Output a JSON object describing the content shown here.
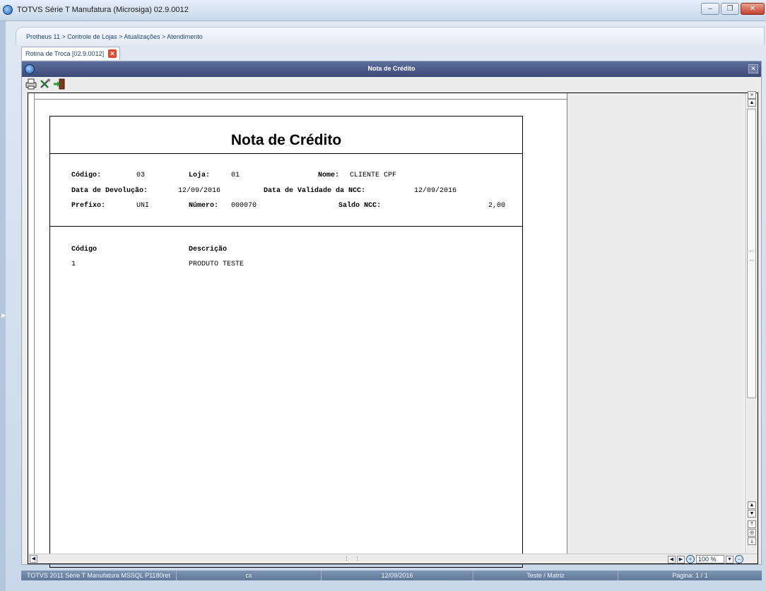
{
  "window": {
    "title": "TOTVS Série T Manufatura (Microsiga) 02.9.0012",
    "min_label": "–",
    "max_label": "❐",
    "close_label": "✕"
  },
  "breadcrumb": "Protheus 11 > Controle de Lojas > Atualizações > Atendimento",
  "tab": {
    "label": "Rotina de Troca [02.9.0012]",
    "close_label": "✕"
  },
  "dialog": {
    "title": "Nota de Crédito",
    "close_label": "✕"
  },
  "toolbar": {
    "icons": [
      "printer-icon",
      "tools-icon",
      "exit-icon"
    ]
  },
  "report": {
    "title": "Nota de Crédito",
    "fields": {
      "codigo_label": "Código:",
      "codigo": "03",
      "loja_label": "Loja:",
      "loja": "01",
      "nome_label": "Nome:",
      "nome": "CLIENTE CPF",
      "data_devolucao_label": "Data de Devolução:",
      "data_devolucao": "12/09/2016",
      "data_validade_label": "Data de Validade da NCC:",
      "data_validade": "12/09/2016",
      "prefixo_label": "Prefixo:",
      "prefixo": "UNI",
      "numero_label": "Número:",
      "numero": "000070",
      "saldo_label": "Saldo NCC:",
      "saldo": "2,00"
    },
    "items_table": {
      "headers": [
        "Código",
        "Descrição"
      ],
      "rows": [
        [
          "1",
          "PRODUTO TESTE"
        ]
      ]
    }
  },
  "zoom": {
    "value": "100 %"
  },
  "statusbar": [
    "TOTVS 2011 Série T Manufatura MSSQL P1180ret",
    "cx",
    "12/09/2016",
    "Teste / Matriz",
    "Página: 1 / 1"
  ]
}
